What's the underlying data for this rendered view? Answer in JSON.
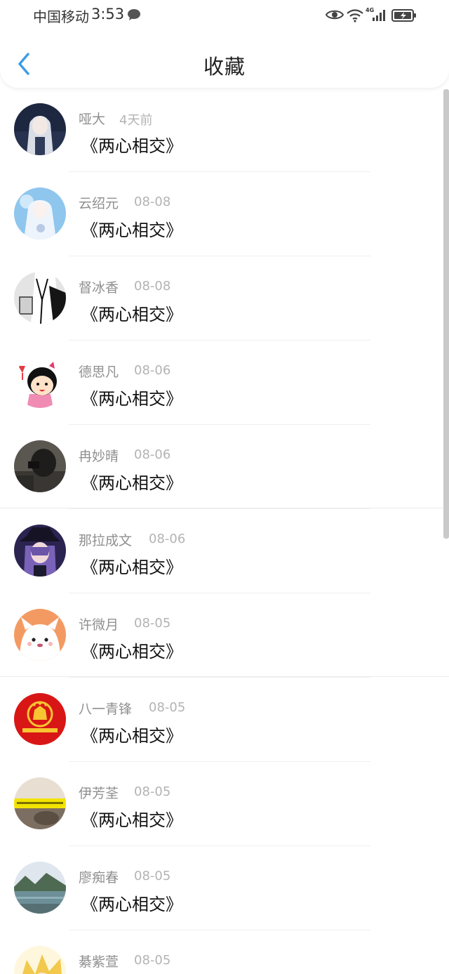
{
  "status_bar": {
    "carrier": "中国移动",
    "time": "3:53",
    "network": "4G"
  },
  "header": {
    "title": "收藏"
  },
  "items": [
    {
      "name": "哑大",
      "date": "4天前",
      "work": "《两心相交》",
      "avatar": "anime-girl-dark"
    },
    {
      "name": "云绍元",
      "date": "08-08",
      "work": "《两心相交》",
      "avatar": "anime-girl-white"
    },
    {
      "name": "督冰香",
      "date": "08-08",
      "work": "《两心相交》",
      "avatar": "manga-suit"
    },
    {
      "name": "德思凡",
      "date": "08-06",
      "work": "《两心相交》",
      "avatar": "cartoon-girl-wine"
    },
    {
      "name": "冉妙晴",
      "date": "08-06",
      "work": "《两心相交》",
      "avatar": "photo-dark"
    },
    {
      "name": "那拉成文",
      "date": "08-06",
      "work": "《两心相交》",
      "avatar": "anime-boy-hat"
    },
    {
      "name": "许微月",
      "date": "08-05",
      "work": "《两心相交》",
      "avatar": "cartoon-dog"
    },
    {
      "name": "八一青锋",
      "date": "08-05",
      "work": "《两心相交》",
      "avatar": "national-emblem"
    },
    {
      "name": "伊芳荃",
      "date": "08-05",
      "work": "《两心相交》",
      "avatar": "photo-banner"
    },
    {
      "name": "廖痴春",
      "date": "08-05",
      "work": "《两心相交》",
      "avatar": "landscape-lake"
    },
    {
      "name": "綦紫萱",
      "date": "08-05",
      "work": "",
      "avatar": "anime-yellow"
    }
  ],
  "colors": {
    "accent": "#3b9ce8",
    "name_text": "#8f8f8f",
    "date_text": "#b3b3b3"
  }
}
